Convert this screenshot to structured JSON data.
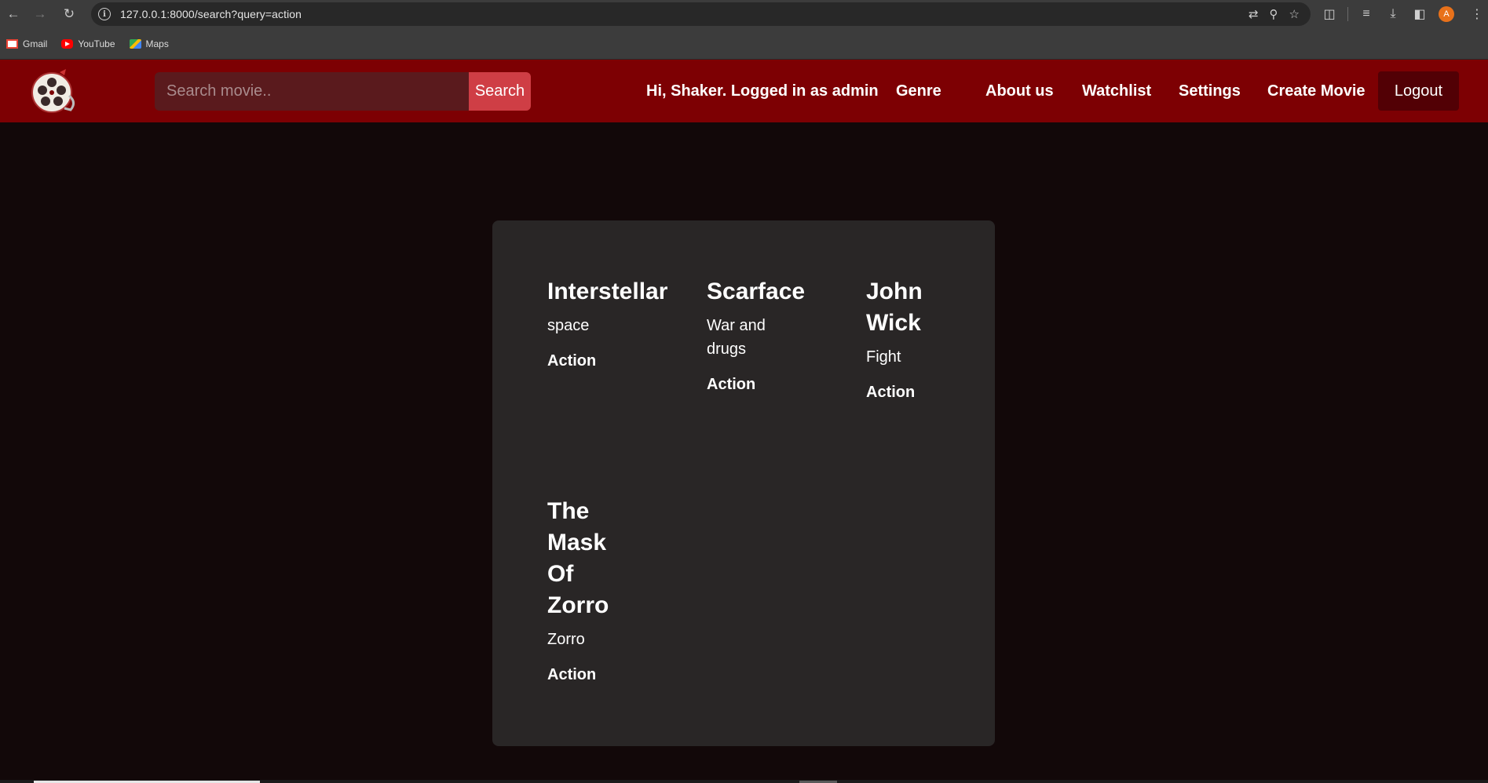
{
  "browser": {
    "url": "127.0.0.1:8000/search?query=action",
    "bookmarks": [
      {
        "label": "Gmail",
        "icon": "gmail-icon"
      },
      {
        "label": "YouTube",
        "icon": "youtube-icon"
      },
      {
        "label": "Maps",
        "icon": "maps-icon"
      }
    ],
    "profile_initial": "A"
  },
  "navbar": {
    "search_placeholder": "Search movie..",
    "search_button": "Search",
    "greeting": "Hi, Shaker. Logged in as admin",
    "links": {
      "genre": "Genre",
      "about": "About us",
      "watchlist": "Watchlist",
      "settings": "Settings",
      "create_movie": "Create Movie"
    },
    "logout": "Logout"
  },
  "movies": [
    {
      "title": "Interstellar",
      "description": "space",
      "genre": "Action"
    },
    {
      "title": "Scarface",
      "description": "War and drugs",
      "genre": "Action"
    },
    {
      "title": "John Wick",
      "description": "Fight",
      "genre": "Action"
    },
    {
      "title": "The Mask Of Zorro",
      "description": "Zorro",
      "genre": "Action"
    }
  ],
  "colors": {
    "navbar": "#7d0003",
    "page_bg": "#120809",
    "card_bg": "#292626",
    "search_button": "#cf3e45",
    "logout_bg": "#520005"
  }
}
